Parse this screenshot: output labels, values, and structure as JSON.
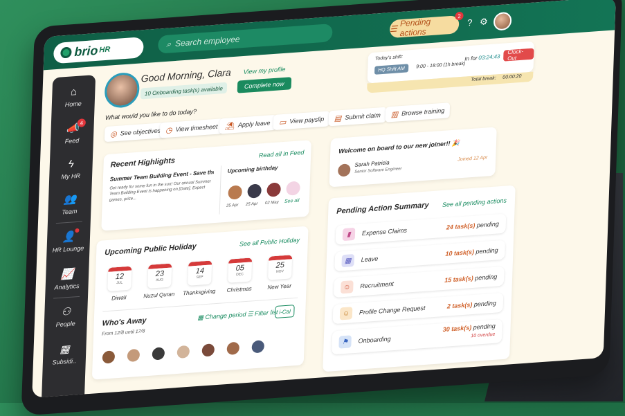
{
  "app": {
    "logo": "brio",
    "logo_suffix": "HR"
  },
  "topbar": {
    "search_placeholder": "Search employee",
    "pending_label": "Pending actions",
    "pending_badge": "2"
  },
  "greeting": {
    "title": "Good Morning, Clara",
    "view_profile": "View my profile",
    "onboarding_tag": "10 Onboarding task(s) available",
    "complete_button": "Complete now",
    "prompt": "What would you like to do today?"
  },
  "shift": {
    "today_label": "Today's shift:",
    "shift_name": "HQ Shift AM",
    "shift_time": "9:00 - 18:00 (1h break)",
    "in_for_label": "In for",
    "in_for_time": "03:24:43",
    "clockout_label": "Clock-Out",
    "total_break_label": "Total break:",
    "total_break_value": "00:00:20"
  },
  "quick_actions": [
    "See objectives",
    "View timesheet",
    "Apply leave",
    "View payslip",
    "Submit claim",
    "Browse training"
  ],
  "sidebar": {
    "items": [
      {
        "label": "Home",
        "icon": "home-icon"
      },
      {
        "label": "Feed",
        "icon": "megaphone-icon",
        "badge": "4"
      },
      {
        "label": "My HR",
        "icon": "bolt-icon"
      },
      {
        "label": "Team",
        "icon": "team-icon"
      },
      {
        "label": "HR Lounge",
        "icon": "lounge-icon"
      },
      {
        "label": "Analytics",
        "icon": "chart-icon"
      },
      {
        "label": "People",
        "icon": "org-icon"
      },
      {
        "label": "Subsidi..",
        "icon": "building-icon"
      }
    ]
  },
  "highlights": {
    "title": "Recent Highlights",
    "read_all": "Read all in Feed",
    "event_title": "Summer Team Building Event - Save the Dat...",
    "event_text": "Get ready for some fun in the sun! Our annual Summer Team Building Event is happening on [Date]. Expect games, prize...",
    "birthday_title": "Upcoming birthday",
    "birthdays": [
      "25 Apr",
      "25 Apr",
      "02 May"
    ],
    "see_all": "See all"
  },
  "joiner": {
    "title": "Welcome on board to our new joiner!! 🎉",
    "name": "Sarah Patricia",
    "role": "Senior Software Engineer",
    "joined": "Joined 12 Apr"
  },
  "holidays": {
    "title": "Upcoming Public Holiday",
    "see_all": "See all Public Holiday",
    "items": [
      {
        "day": "12",
        "month": "JUL",
        "name": "Diwali"
      },
      {
        "day": "23",
        "month": "AUG",
        "name": "Nuzul Quran"
      },
      {
        "day": "14",
        "month": "SEP",
        "name": "Thanksgiving"
      },
      {
        "day": "05",
        "month": "DEC",
        "name": "Christmas"
      },
      {
        "day": "25",
        "month": "NOV",
        "name": "New Year"
      }
    ]
  },
  "away": {
    "title": "Who's Away",
    "range": "From 12/8 until 17/8",
    "change_period": "Change period",
    "filter_list": "Filter list",
    "ical": "i-Cal"
  },
  "pending": {
    "title": "Pending Action Summary",
    "see_all": "See all pending actions",
    "items": [
      {
        "name": "Expense Claims",
        "count": "24 task(s)",
        "suffix": "pending",
        "color": "#e07bb3",
        "icon": "receipt-icon"
      },
      {
        "name": "Leave",
        "count": "10 task(s)",
        "suffix": "pending",
        "color": "#7c7fd6",
        "icon": "calendar-icon"
      },
      {
        "name": "Recruitment",
        "count": "15 task(s)",
        "suffix": "pending",
        "color": "#e2704e",
        "icon": "recruit-icon"
      },
      {
        "name": "Profile Change Request",
        "count": "2 task(s)",
        "suffix": "pending",
        "color": "#e0a24e",
        "icon": "profile-icon"
      },
      {
        "name": "Onboarding",
        "count": "30 task(s)",
        "suffix": "pending",
        "color": "#4e7fd6",
        "icon": "onboard-icon",
        "overdue": "10 overdue"
      }
    ]
  }
}
